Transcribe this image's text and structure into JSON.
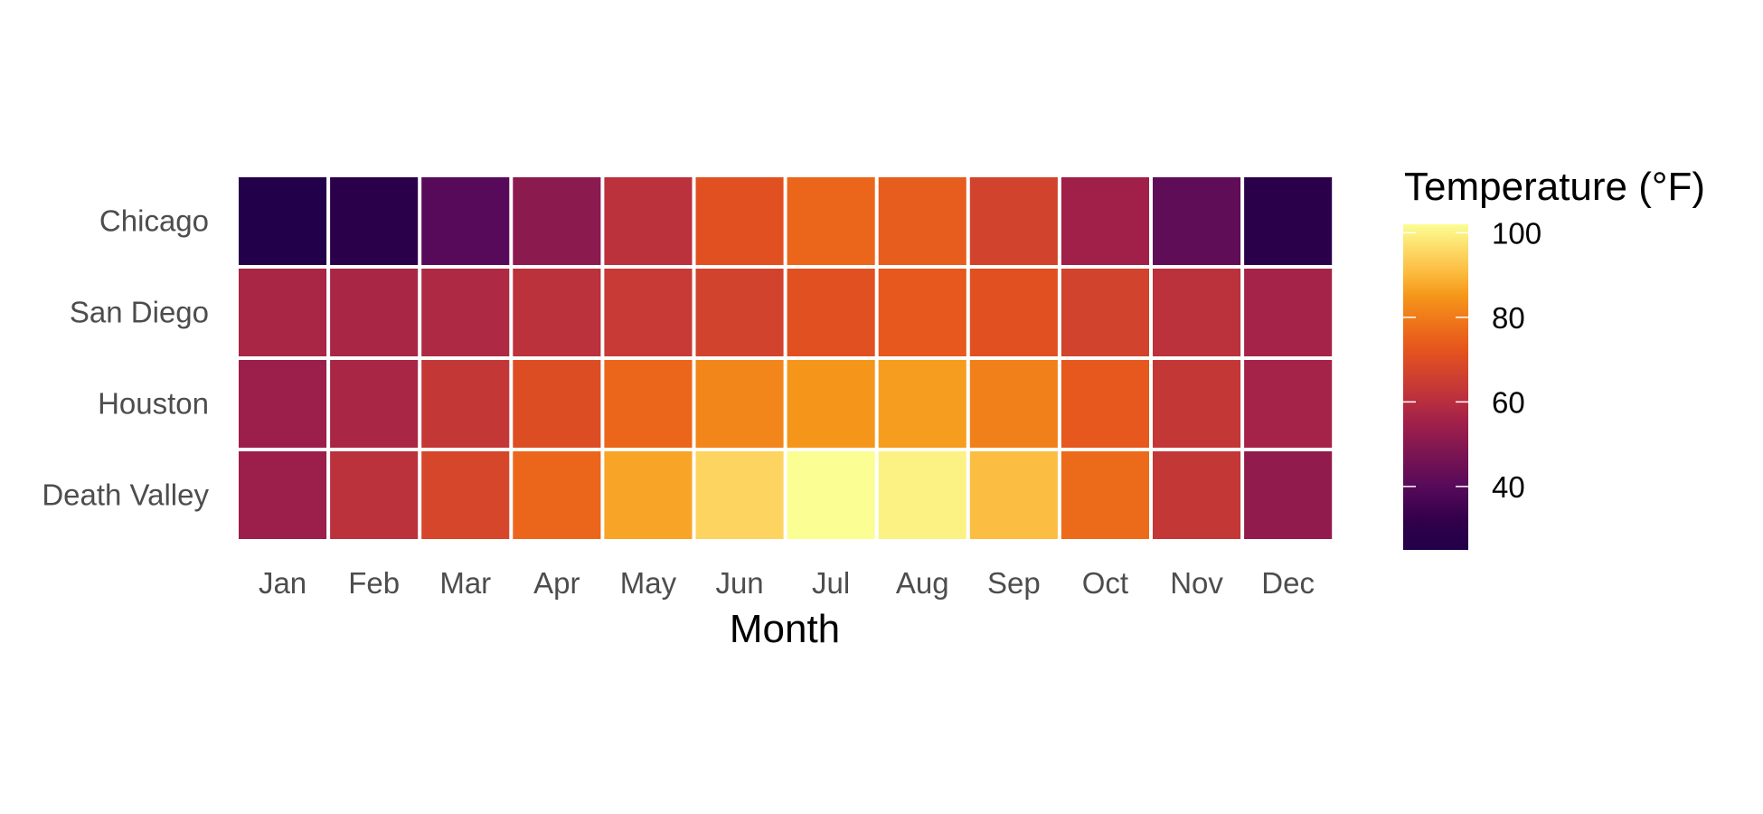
{
  "chart_data": {
    "type": "heatmap",
    "title": "",
    "xlabel": "Month",
    "ylabel": "",
    "x": [
      "Jan",
      "Feb",
      "Mar",
      "Apr",
      "May",
      "Jun",
      "Jul",
      "Aug",
      "Sep",
      "Oct",
      "Nov",
      "Dec"
    ],
    "y": [
      "Chicago",
      "San Diego",
      "Houston",
      "Death Valley"
    ],
    "values": [
      [
        25,
        29,
        40,
        51,
        61,
        71,
        76,
        74,
        67,
        55,
        42,
        29
      ],
      [
        57,
        57,
        58,
        61,
        64,
        67,
        71,
        73,
        71,
        67,
        61,
        56
      ],
      [
        54,
        57,
        63,
        70,
        76,
        82,
        85,
        86,
        81,
        73,
        63,
        56
      ],
      [
        54,
        61,
        68,
        76,
        87,
        95,
        102,
        100,
        91,
        77,
        63,
        52
      ]
    ],
    "legend": {
      "title": "Temperature (°F)",
      "position": "right",
      "range": [
        25,
        102
      ],
      "ticks": [
        40,
        60,
        80,
        100
      ],
      "tick_labels": [
        "40",
        "60",
        "80",
        "100"
      ]
    },
    "colorscale": {
      "name": "inferno",
      "stops": [
        [
          25,
          "#22004a"
        ],
        [
          32,
          "#32004a"
        ],
        [
          40,
          "#570a5a"
        ],
        [
          48,
          "#7c1552"
        ],
        [
          55,
          "#a0204a"
        ],
        [
          62,
          "#c0343a"
        ],
        [
          68,
          "#d6462a"
        ],
        [
          72,
          "#e4531e"
        ],
        [
          78,
          "#ee701a"
        ],
        [
          85,
          "#f5961a"
        ],
        [
          90,
          "#fbb83a"
        ],
        [
          95,
          "#fdd460"
        ],
        [
          102,
          "#fbfe92"
        ]
      ]
    },
    "grid": false
  }
}
